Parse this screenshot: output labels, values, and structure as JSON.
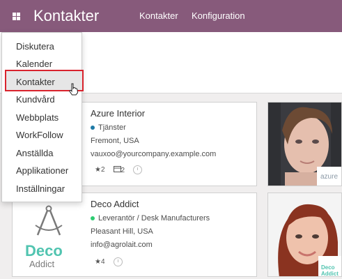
{
  "navbar": {
    "brand": "Kontakter",
    "links": [
      "Kontakter",
      "Konfiguration"
    ],
    "color": "#875a7b"
  },
  "menu": {
    "items": [
      "Diskutera",
      "Kalender",
      "Kontakter",
      "Kundvård",
      "Webbplats",
      "WorkFollow",
      "Anställda",
      "Applikationer",
      "Inställningar"
    ],
    "highlighted": "Kontakter",
    "highlight_border": "#d9232d"
  },
  "cards": [
    {
      "name": "Azure Interior",
      "tag": "Tjänster",
      "tag_color": "#1f7aa6",
      "location": "Fremont, USA",
      "email": "vauxoo@yourcompany.example.com",
      "stars": "2",
      "meetings": "2",
      "company_logo_text": "azure"
    },
    {
      "name": "Deco Addict",
      "tag": "Leverantör / Desk Manufacturers",
      "tag_color": "#2ecc71",
      "location": "Pleasant Hill, USA",
      "email": "info@agrolait.com",
      "stars": "4",
      "logo_word1": "Deco",
      "logo_word2": "Addict",
      "logo_color": "#51c4b0",
      "company_logo_text": "Deco Addict"
    }
  ]
}
